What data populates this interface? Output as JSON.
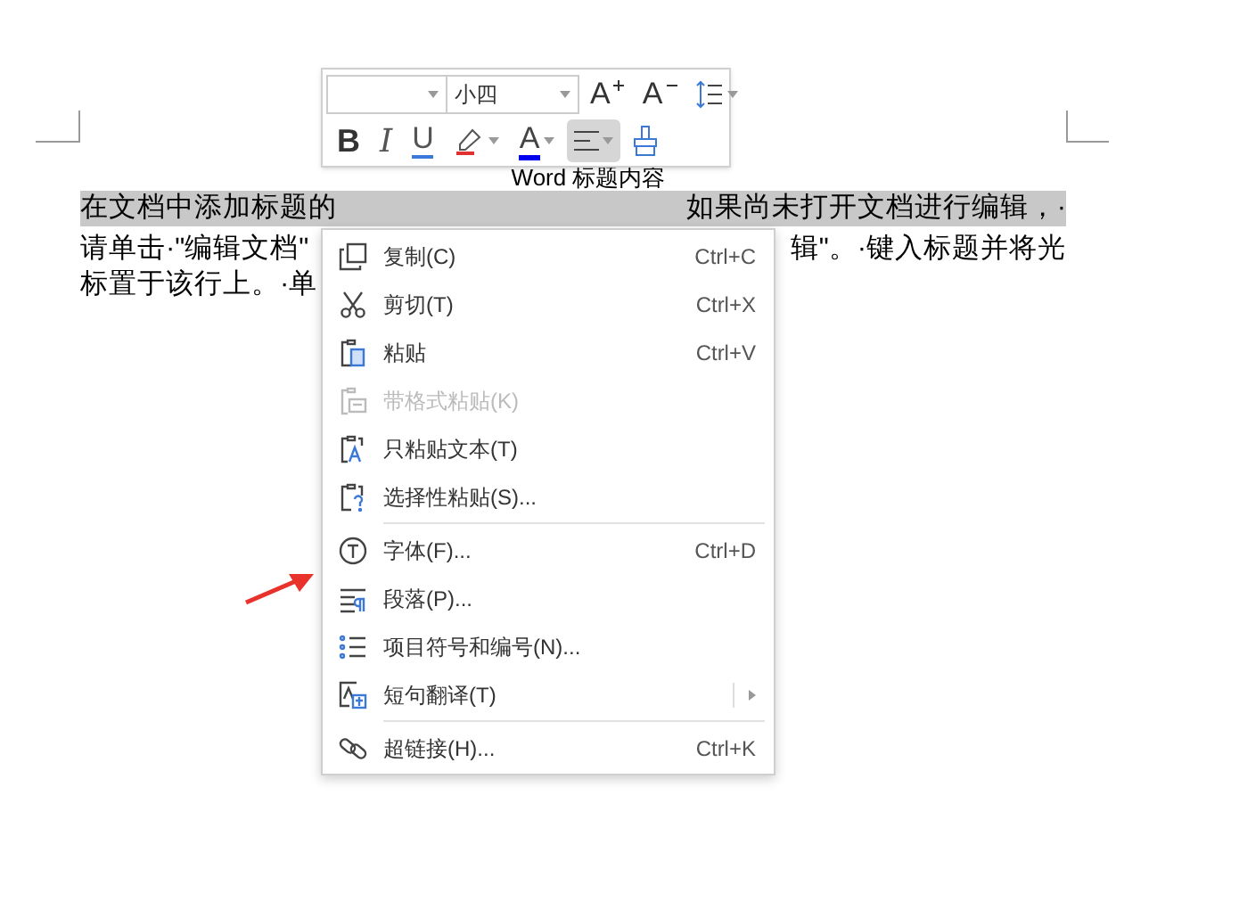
{
  "document": {
    "title_text": "Word 标题内容",
    "line_1_start": "在文档中添加标题的",
    "line_1_end": "如果尚未打开文档进行编辑，·",
    "line_2_start": "请单击·\"编辑文档\"",
    "line_2_end": "辑\"。·键入标题并将光",
    "line_3_start": "标置于该行上。·单"
  },
  "toolbar": {
    "font_size": "小四",
    "buttons": [
      {
        "kind": "grow",
        "label": "A",
        "selected": false
      },
      {
        "kind": "shrink",
        "label": "A",
        "selected": false
      },
      {
        "kind": "spacing",
        "selected": false
      }
    ],
    "format_buttons": [
      {
        "kind": "bold",
        "label": "B",
        "selected": false
      },
      {
        "kind": "italic",
        "label": "I",
        "selected": false
      },
      {
        "kind": "underline",
        "label": "U",
        "selected": false
      },
      {
        "kind": "highlight",
        "selected": false
      },
      {
        "kind": "color",
        "label": "A",
        "selected": false
      },
      {
        "kind": "align",
        "selected": true
      },
      {
        "kind": "painter",
        "selected": false
      }
    ]
  },
  "context_menu": [
    {
      "kind": "item",
      "label": "复制(C)",
      "shortcut": "Ctrl+C",
      "disabled": false
    },
    {
      "kind": "item",
      "label": "剪切(T)",
      "shortcut": "Ctrl+X",
      "disabled": false
    },
    {
      "kind": "item",
      "label": "粘贴",
      "shortcut": "Ctrl+V",
      "disabled": false
    },
    {
      "kind": "item",
      "label": "带格式粘贴(K)",
      "disabled": true
    },
    {
      "kind": "item",
      "label": "只粘贴文本(T)",
      "disabled": false
    },
    {
      "kind": "item",
      "label": "选择性粘贴(S)...",
      "disabled": false
    },
    {
      "kind": "separator"
    },
    {
      "kind": "item",
      "label": "字体(F)...",
      "shortcut": "Ctrl+D",
      "disabled": false
    },
    {
      "kind": "item",
      "label": "段落(P)...",
      "disabled": false
    },
    {
      "kind": "item",
      "label": "项目符号和编号(N)...",
      "disabled": false
    },
    {
      "kind": "submenu",
      "label": "短句翻译(T)",
      "disabled": false
    },
    {
      "kind": "separator"
    },
    {
      "kind": "item",
      "label": "超链接(H)...",
      "shortcut": "Ctrl+K",
      "disabled": false
    }
  ]
}
